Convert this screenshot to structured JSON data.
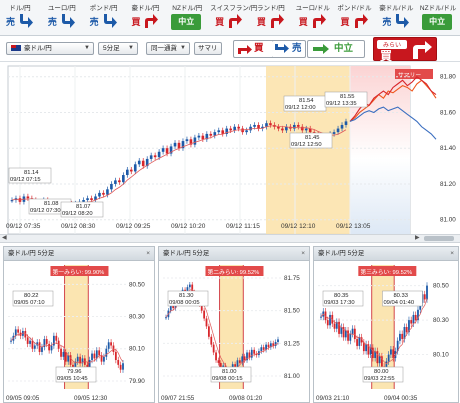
{
  "ticker": [
    {
      "pair": "ドル/円",
      "signal": "sell",
      "label": "売"
    },
    {
      "pair": "ユーロ/円",
      "signal": "sell",
      "label": "売"
    },
    {
      "pair": "ポンド/円",
      "signal": "sell",
      "label": "売"
    },
    {
      "pair": "豪ドル/円",
      "signal": "buy",
      "label": "買"
    },
    {
      "pair": "NZドル/円",
      "signal": "neutral",
      "label": "中立"
    },
    {
      "pair": "スイスフラン/円",
      "signal": "buy",
      "label": "買"
    },
    {
      "pair": "ランド/円",
      "signal": "buy",
      "label": "買"
    },
    {
      "pair": "ユーロ/ドル",
      "signal": "buy",
      "label": "買"
    },
    {
      "pair": "ポンド/ドル",
      "signal": "buy",
      "label": "買"
    },
    {
      "pair": "豪ドル/ドル",
      "signal": "sell",
      "label": "売"
    },
    {
      "pair": "NZドル/ドル",
      "signal": "neutral",
      "label": "中立"
    }
  ],
  "toolbar": {
    "pair_select": "豪ドル/円",
    "interval_select": "5分足",
    "pattern_select": "同一通貨",
    "summary_button": "サマリ",
    "buy_label": "買",
    "sell_label": "売",
    "neutral_label": "中立",
    "memo_top": "みらい",
    "memo_main": "買"
  },
  "colors": {
    "buy": "#c8171e",
    "sell": "#1d5aa8",
    "neutral": "#3a9b3a",
    "highlight": "#fbe2a8",
    "up_candle": "#1d5aa8",
    "down_candle": "#d8262b"
  },
  "main_chart": {
    "summary_label": "サマリー",
    "y_ticks": [
      "81.80",
      "81.60",
      "81.40",
      "81.20",
      "81.00"
    ],
    "x_ticks": [
      "09/12 07:35",
      "09/12 08:30",
      "09/12 09:25",
      "09/12 10:20",
      "09/12 11:15",
      "09/12 12:10",
      "09/12 13:05"
    ],
    "annotations": [
      {
        "price": "81.14",
        "time": "09/12 07:15"
      },
      {
        "price": "81.08",
        "time": "09/12 07:30"
      },
      {
        "price": "81.07",
        "time": "09/12 08:20"
      },
      {
        "price": "81.54",
        "time": "09/12 12:00"
      },
      {
        "price": "81.45",
        "time": "09/12 12:50"
      },
      {
        "price": "81.55",
        "time": "09/12 13:35"
      }
    ]
  },
  "chart_data": {
    "type": "candlestick",
    "y_range": [
      80.92,
      81.86
    ],
    "y_ticks": [
      81.8,
      81.6,
      81.4,
      81.2,
      81.0
    ],
    "close_series": [
      81.11,
      81.12,
      81.1,
      81.13,
      81.12,
      81.11,
      81.1,
      81.09,
      81.11,
      81.1,
      81.09,
      81.08,
      81.09,
      81.1,
      81.09,
      81.08,
      81.09,
      81.1,
      81.11,
      81.12,
      81.11,
      81.13,
      81.15,
      81.14,
      81.17,
      81.2,
      81.22,
      81.21,
      81.25,
      81.28,
      81.27,
      81.31,
      81.33,
      81.3,
      81.34,
      81.36,
      81.35,
      81.38,
      81.4,
      81.37,
      81.41,
      81.43,
      81.4,
      81.44,
      81.45,
      81.42,
      81.46,
      81.47,
      81.45,
      81.48,
      81.47,
      81.49,
      81.5,
      81.48,
      81.51,
      81.5,
      81.52,
      81.51,
      81.49,
      81.5,
      81.52,
      81.53,
      81.51,
      81.52,
      81.54,
      81.53,
      81.52,
      81.51,
      81.5,
      81.52,
      81.51,
      81.53,
      81.52,
      81.5,
      81.51,
      81.49,
      81.48,
      81.46,
      81.47,
      81.46,
      81.48,
      81.49,
      81.51,
      81.53,
      81.55
    ],
    "forecast": [
      {
        "name": "predict-a",
        "values": [
          81.55,
          81.57,
          81.6,
          81.62,
          81.64,
          81.67,
          81.7,
          81.68,
          81.72,
          81.71,
          81.73,
          81.75,
          81.74,
          81.72,
          81.76,
          81.78,
          81.75,
          81.72,
          81.68
        ]
      },
      {
        "name": "predict-b",
        "values": [
          81.55,
          81.58,
          81.62,
          81.65,
          81.64,
          81.68,
          81.7,
          81.72,
          81.7,
          81.74,
          81.76,
          81.78,
          81.75,
          81.77,
          81.8,
          81.78,
          81.76,
          81.72,
          81.7
        ]
      },
      {
        "name": "predict-c",
        "values": [
          81.55,
          81.56,
          81.58,
          81.6,
          81.61,
          81.6,
          81.62,
          81.63,
          81.61,
          81.62,
          81.63,
          81.61,
          81.59,
          81.57,
          81.55,
          81.52,
          81.5,
          81.48,
          81.45
        ]
      }
    ]
  },
  "sub_charts": [
    {
      "title": "豪ドル/円 5分足",
      "match_label": "第一みらい: 99.90%",
      "y_ticks": [
        "80.50",
        "80.30",
        "80.10",
        "79.90"
      ],
      "x_ticks": [
        "09/05 09:05",
        "09/05 12:30"
      ],
      "ann_high": {
        "price": "80.22",
        "time": "09/05 07:10"
      },
      "ann_low": {
        "price": "79.96",
        "time": "09/05 10:45"
      },
      "y_range": [
        79.85,
        80.62
      ],
      "series": [
        80.15,
        80.18,
        80.22,
        80.2,
        80.18,
        80.21,
        80.17,
        80.13,
        80.15,
        80.1,
        80.12,
        80.14,
        80.08,
        80.11,
        80.16,
        80.13,
        80.09,
        80.12,
        80.18,
        80.15,
        80.1,
        80.05,
        80.08,
        80.02,
        80.06,
        80.0,
        79.96,
        80.02,
        80.05,
        80.01,
        80.04,
        80.0,
        79.98,
        80.03,
        80.07,
        80.04,
        80.09,
        80.06,
        80.02,
        80.05,
        80.1,
        80.14,
        80.12,
        80.08,
        80.03,
        80.0,
        79.97,
        80.01
      ]
    },
    {
      "title": "豪ドル/円 5分足",
      "match_label": "第二みらい: 99.52%",
      "y_ticks": [
        "81.75",
        "81.50",
        "81.25",
        "81.00"
      ],
      "x_ticks": [
        "09/07 21:55",
        "09/08 01:20"
      ],
      "ann_high": {
        "price": "81.30",
        "time": "09/08 00:05"
      },
      "ann_low": {
        "price": "81.00",
        "time": "09/08 00:15"
      },
      "y_range": [
        80.9,
        81.85
      ],
      "series": [
        81.45,
        81.5,
        81.55,
        81.52,
        81.58,
        81.6,
        81.62,
        81.66,
        81.63,
        81.68,
        81.7,
        81.64,
        81.58,
        81.62,
        81.55,
        81.5,
        81.44,
        81.38,
        81.3,
        81.24,
        81.18,
        81.12,
        81.1,
        81.06,
        81.08,
        81.04,
        81.0,
        81.05,
        81.09,
        81.07,
        81.12,
        81.1,
        81.15,
        81.12,
        81.18,
        81.14,
        81.2,
        81.17,
        81.16,
        81.19,
        81.22,
        81.2,
        81.24,
        81.22,
        81.25,
        81.23,
        81.26,
        81.28
      ]
    },
    {
      "title": "豪ドル/円 5分足",
      "match_label": "第三みらい: 99.52%",
      "y_ticks": [
        "80.50",
        "80.30",
        "80.10"
      ],
      "x_ticks": [
        "09/03 21:10",
        "09/04 00:35"
      ],
      "ann_high": {
        "price": "80.35",
        "time": "09/03 17:30"
      },
      "ann_low": {
        "price": "80.00",
        "time": "09/03 22:55"
      },
      "ann_mid": {
        "price": "80.33",
        "time": "09/04 01:40"
      },
      "y_range": [
        79.9,
        80.62
      ],
      "series": [
        80.32,
        80.35,
        80.3,
        80.27,
        80.33,
        80.28,
        80.25,
        80.29,
        80.22,
        80.26,
        80.2,
        80.24,
        80.18,
        80.22,
        80.25,
        80.19,
        80.15,
        80.2,
        80.17,
        80.12,
        80.16,
        80.1,
        80.14,
        80.08,
        80.12,
        80.05,
        80.09,
        80.03,
        80.0,
        80.06,
        80.1,
        80.13,
        80.08,
        80.12,
        80.18,
        80.22,
        80.19,
        80.26,
        80.23,
        80.3,
        80.28,
        80.33,
        80.3,
        80.36,
        80.4,
        80.45,
        80.42,
        80.5
      ]
    }
  ]
}
